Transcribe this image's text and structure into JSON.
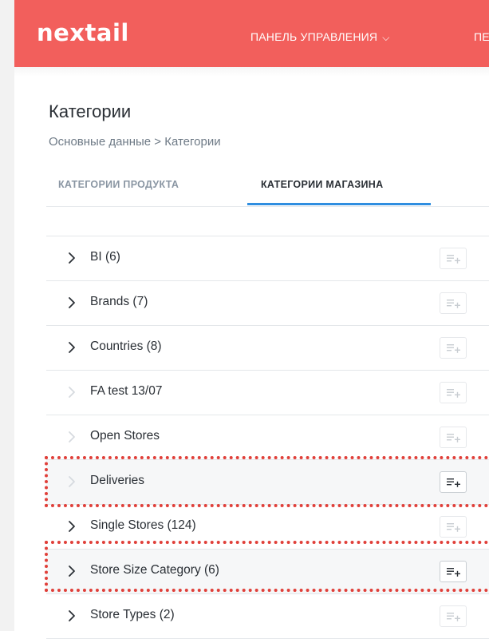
{
  "header": {
    "logo_text": "nextail",
    "nav": [
      {
        "label": "ПАНЕЛЬ УПРАВЛЕНИЯ",
        "has_dropdown": true,
        "icon": "chevron-down-icon"
      },
      {
        "label": "ПЕ",
        "has_dropdown": false
      }
    ]
  },
  "page": {
    "title": "Категории",
    "breadcrumb": "Основные данные > Категории"
  },
  "tabs": [
    {
      "label": "КАТЕГОРИИ ПРОДУКТА",
      "active": false
    },
    {
      "label": "КАТЕГОРИИ МАГАЗИНА",
      "active": true
    }
  ],
  "categories": [
    {
      "label": "BI (6)",
      "expandable": true,
      "add_enabled": false
    },
    {
      "label": "Brands (7)",
      "expandable": true,
      "add_enabled": false
    },
    {
      "label": "Countries (8)",
      "expandable": true,
      "add_enabled": false
    },
    {
      "label": "FA test 13/07",
      "expandable": false,
      "add_enabled": false
    },
    {
      "label": "Open Stores",
      "expandable": false,
      "add_enabled": false
    },
    {
      "label": "Deliveries",
      "expandable": false,
      "add_enabled": true,
      "highlighted": true
    },
    {
      "label": "Single Stores (124)",
      "expandable": true,
      "add_enabled": false
    },
    {
      "label": "Store Size Category (6)",
      "expandable": true,
      "add_enabled": true,
      "highlighted": true
    },
    {
      "label": "Store Types (2)",
      "expandable": true,
      "add_enabled": false
    }
  ],
  "colors": {
    "header_bg": "#f25f5c",
    "tab_active_underline": "#2f8ee0",
    "highlight_border": "#e0403a",
    "icon_active": "#2a2f35",
    "icon_disabled": "#c8cdd2"
  }
}
